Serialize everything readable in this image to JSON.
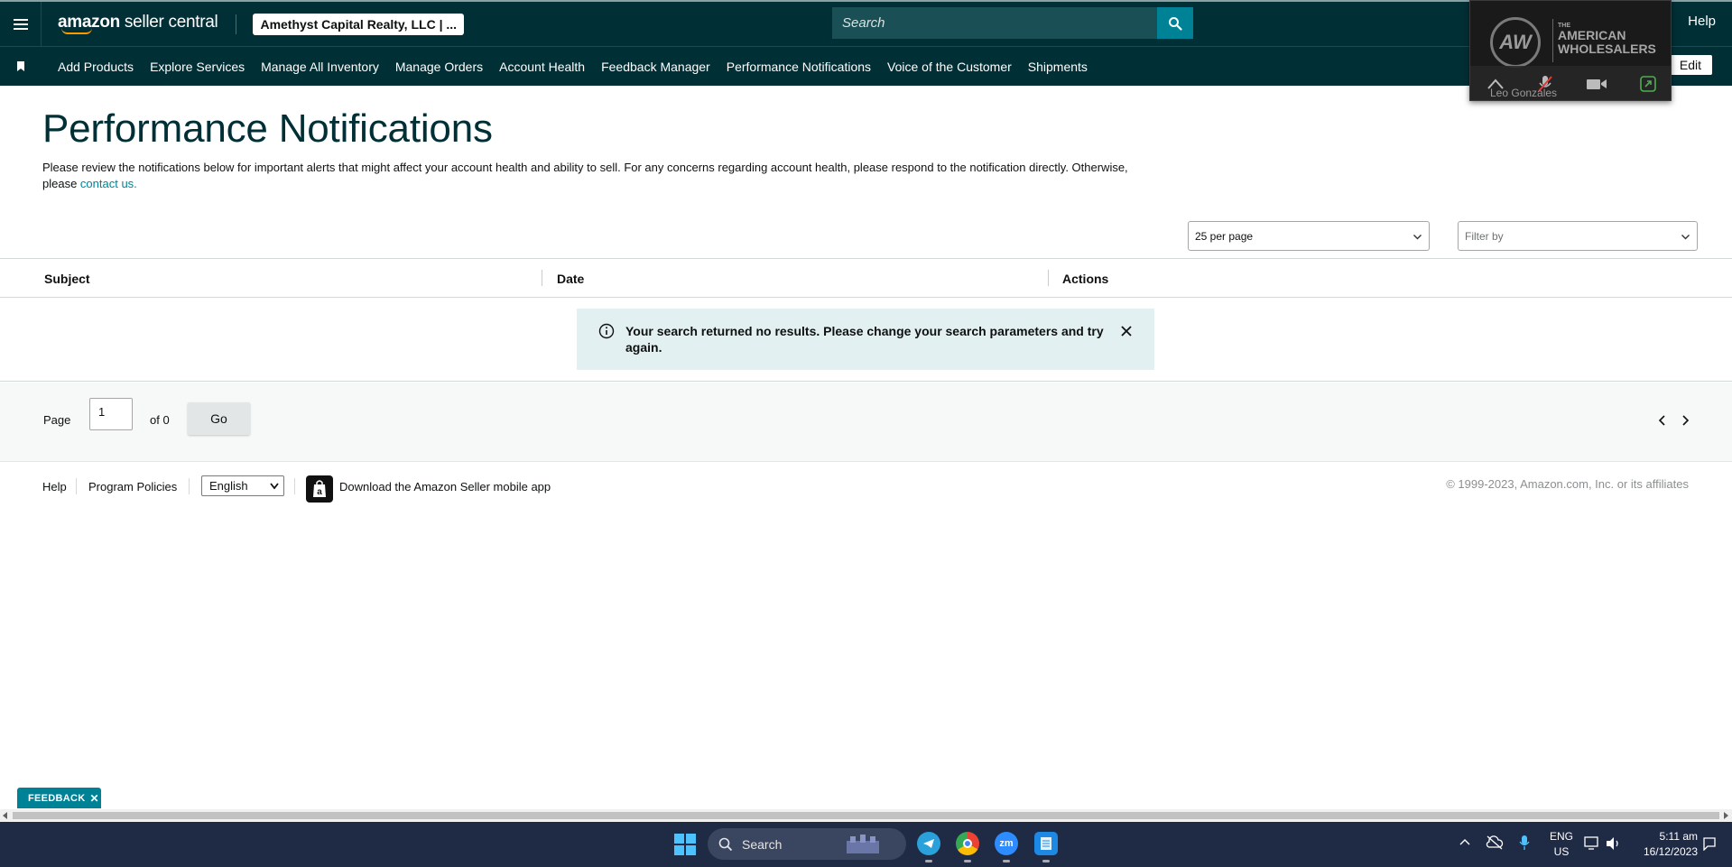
{
  "topbar": {
    "logo_bold": "amazon",
    "logo_rest": " seller central",
    "account_name": "Amethyst Capital Realty, LLC | ...",
    "search_placeholder": "Search",
    "help_label": "Help"
  },
  "nav": {
    "items": [
      {
        "label": "Add Products"
      },
      {
        "label": "Explore Services"
      },
      {
        "label": "Manage All Inventory"
      },
      {
        "label": "Manage Orders"
      },
      {
        "label": "Account Health"
      },
      {
        "label": "Feedback Manager"
      },
      {
        "label": "Performance Notifications"
      },
      {
        "label": "Voice of the Customer"
      },
      {
        "label": "Shipments"
      }
    ],
    "edit_label": "Edit"
  },
  "video_overlay": {
    "logo_initials": "AW",
    "title_small": "THE",
    "title_line1": "AMERICAN",
    "title_line2": "WHOLESALERS",
    "participant": "Leo Gonzales"
  },
  "main": {
    "title": "Performance Notifications",
    "description": "Please review the notifications below for important alerts that might affect your account health and ability to sell. For any concerns regarding account health, please respond to the notification directly. Otherwise, please ",
    "contact_link": "contact us.",
    "per_page": "25 per page",
    "filter_placeholder": "Filter by"
  },
  "table": {
    "columns": [
      "Subject",
      "Date",
      "Actions"
    ],
    "empty_message": "Your search returned no results. Please change your search parameters and try again."
  },
  "pager": {
    "page_label": "Page",
    "page_value": "1",
    "of_label": "of 0",
    "go_label": "Go"
  },
  "footer": {
    "help": "Help",
    "program_policies": "Program Policies",
    "language": "English",
    "download_app": "Download the Amazon Seller mobile app",
    "copyright": "© 1999-2023, Amazon.com, Inc. or its affiliates"
  },
  "feedback_tab": "FEEDBACK",
  "taskbar": {
    "search_label": "Search",
    "lang_line1": "ENG",
    "lang_line2": "US",
    "time": "5:11 am",
    "date": "16/12/2023",
    "zoom_label": "zm"
  },
  "colors": {
    "header_bg": "#002f36",
    "accent_teal": "#008296",
    "alert_bg": "#e3f0f1",
    "taskbar_bg": "#1f2a44"
  }
}
